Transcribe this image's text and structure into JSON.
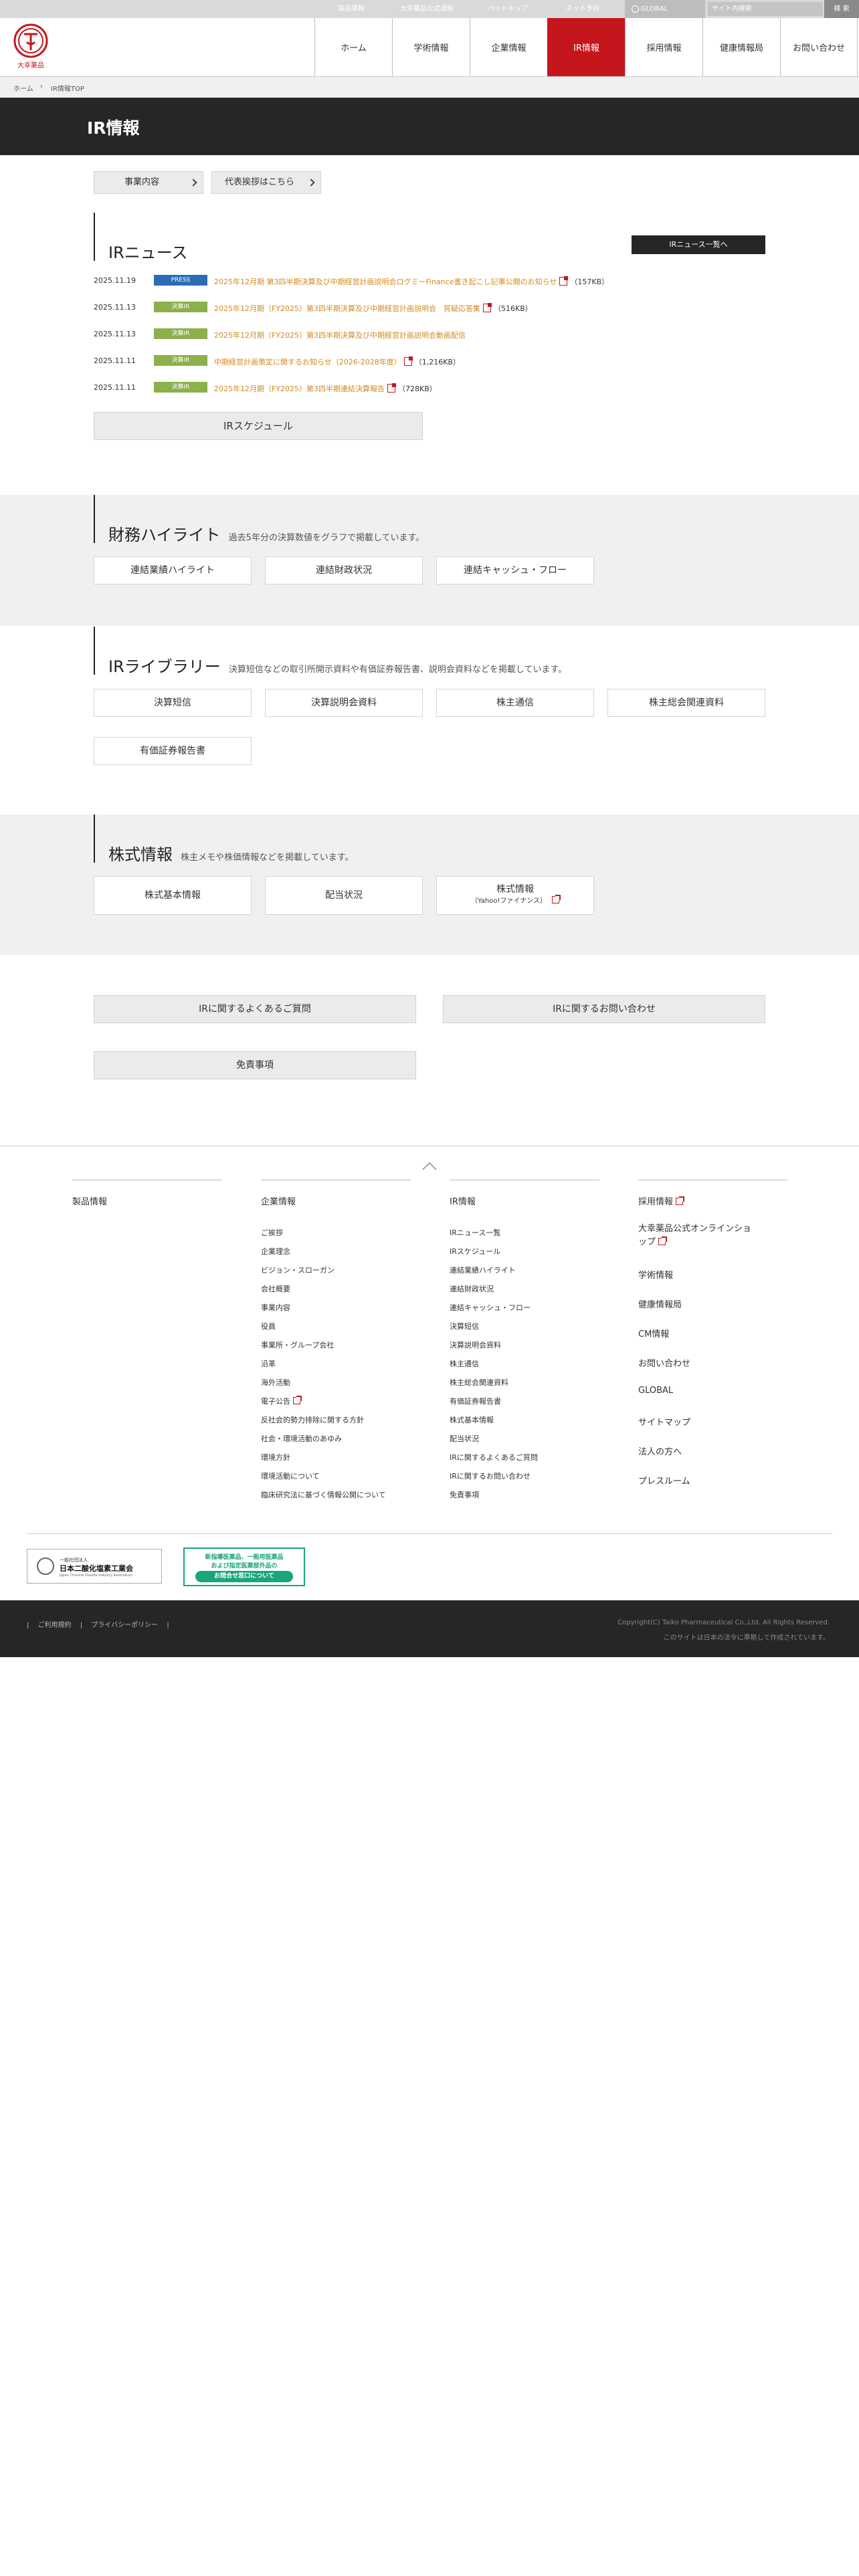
{
  "utility": {
    "links": [
      "製品情報",
      "大幸薬品公式通販",
      "ペットキップ",
      "ネット予約"
    ],
    "global_label": "GLOBAL",
    "search_placeholder": "サイト内検索",
    "search_button": "検 索"
  },
  "header": {
    "logo_text": "大幸薬品",
    "nav": [
      "ホーム",
      "学術情報",
      "企業情報",
      "IR情報",
      "採用情報",
      "健康情報局",
      "お問い合わせ"
    ],
    "active_nav": "IR情報"
  },
  "breadcrumb": {
    "home": "ホーム",
    "separator": "›",
    "current": "IR情報TOP"
  },
  "page_title": "IR情報",
  "top_buttons": [
    "事業内容",
    "代表挨拶はこちら"
  ],
  "ir_news": {
    "title": "IRニュース",
    "all_button": "IRニュース一覧へ",
    "items": [
      {
        "date": "2025.11.19",
        "badge": "PRESS",
        "text": "2025年12月期 第3四半期決算及び中期経営計画説明会ログミーFinance書き起こし記事公開のお知らせ",
        "size": "（157KB）"
      },
      {
        "date": "2025.11.13",
        "badge": "決算IR",
        "text": "2025年12月期（FY2025）第3四半期決算及び中期経営計画説明会　質疑応答集",
        "size": "（516KB）"
      },
      {
        "date": "2025.11.13",
        "badge": "決算IR",
        "text": "2025年12月期（FY2025）第3四半期決算及び中期経営計画説明会動画配信",
        "size": ""
      },
      {
        "date": "2025.11.11",
        "badge": "決算IR",
        "text": "中期経営計画策定に関するお知らせ（2026-2028年度）",
        "size": "（1,216KB）"
      },
      {
        "date": "2025.11.11",
        "badge": "決算IR",
        "text": "2025年12月期（FY2025）第3四半期連結決算報告",
        "size": "（728KB）"
      }
    ],
    "schedule_button": "IRスケジュール"
  },
  "financial_highlight": {
    "title": "財務ハイライト",
    "desc": "過去5年分の決算数値をグラフで掲載しています。",
    "buttons": [
      "連結業績ハイライト",
      "連結財政状況",
      "連結キャッシュ・フロー"
    ]
  },
  "ir_library": {
    "title": "IRライブラリー",
    "desc": "決算短信などの取引所開示資料や有価証券報告書、説明会資料などを掲載しています。",
    "buttons": [
      "決算短信",
      "決算説明会資料",
      "株主通信",
      "株主総会関連資料",
      "有価証券報告書"
    ]
  },
  "stock_info": {
    "title": "株式情報",
    "desc": "株主メモや株価情報などを掲載しています。",
    "buttons": [
      "株式基本情報",
      "配当状況",
      "株式情報"
    ],
    "yahoo_sub": "（Yahoo!ファイナンス）"
  },
  "bottom_buttons": [
    "IRに関するよくあるご質問",
    "IRに関するお問い合わせ",
    "免責事項"
  ],
  "footer": {
    "col1": {
      "head": "製品情報"
    },
    "col2": {
      "head": "企業情報",
      "links": [
        "ご挨拶",
        "企業理念",
        "ビジョン・スローガン",
        "会社概要",
        "事業内容",
        "役員",
        "事業所・グループ会社",
        "沿革",
        "海外活動",
        "電子公告",
        "反社会的勢力排除に関する方針",
        "社会・環境活動のあゆみ",
        "環境方針",
        "環境活動について",
        "臨床研究法に基づく情報公開について"
      ]
    },
    "col3": {
      "head": "IR情報",
      "links": [
        "IRニュース一覧",
        "IRスケジュール",
        "連結業績ハイライト",
        "連結財政状況",
        "連結キャッシュ・フロー",
        "決算短信",
        "決算説明会資料",
        "株主通信",
        "株主総会関連資料",
        "有価証券報告書",
        "株式基本情報",
        "配当状況",
        "IRに関するよくあるご質問",
        "IRに関するお問い合わせ",
        "免責事項"
      ]
    },
    "col4": {
      "items": [
        "採用情報",
        "大幸薬品公式オンラインショップ",
        "学術情報",
        "健康情報局",
        "CM情報",
        "お問い合わせ",
        "GLOBAL",
        "サイトマップ",
        "法人の方へ",
        "プレスルーム"
      ]
    },
    "banner1": {
      "small": "一般社団法人",
      "big": "日本二酸化塩素工業会",
      "en": "Japan Chlorine Dioxide Industry Association"
    },
    "banner2": {
      "line1": "新指導医薬品、一般用医薬品",
      "line2": "および指定医薬部外品の",
      "pill": "お問合せ窓口について"
    },
    "bottom_links": [
      "ご利用規約",
      "プライバシーポリシー"
    ],
    "copyright": "Copyright(C) Taiko Pharmaceutical Co.,Ltd. All Rights Reserved.",
    "notice": "このサイトは日本の法令に準拠して作成されています。"
  }
}
